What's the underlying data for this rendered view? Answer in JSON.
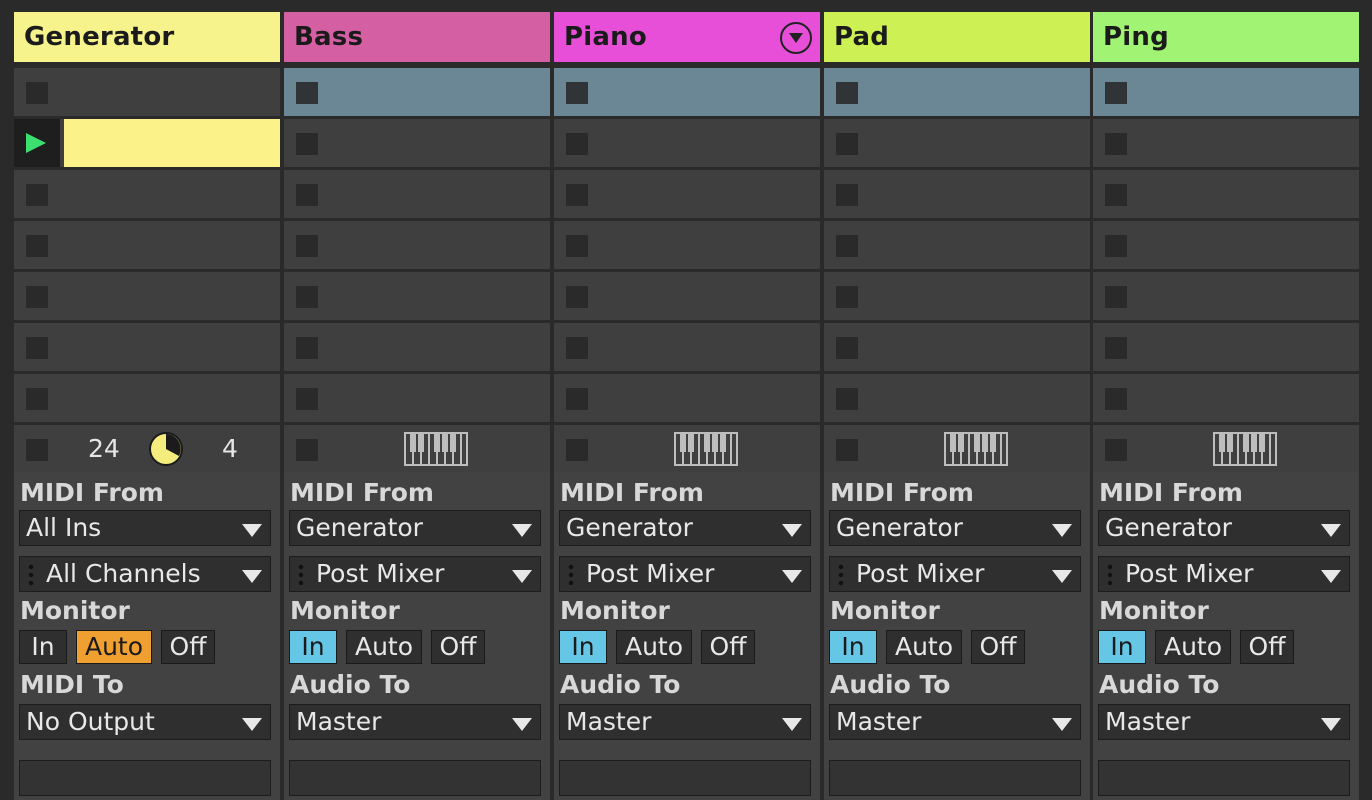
{
  "tracks": [
    {
      "name": "Generator",
      "color": "#f6f38d",
      "has_dropdown": false,
      "midi_from_label": "MIDI From",
      "input_type": "All Ins",
      "input_channel": "All Channels",
      "monitor_label": "Monitor",
      "monitor": {
        "in": "In",
        "auto": "Auto",
        "off": "Off",
        "selected": "Auto"
      },
      "output_label": "MIDI To",
      "output": "No Output",
      "footer": {
        "left_number": "24",
        "right_number": "4"
      }
    },
    {
      "name": "Bass",
      "color": "#d45fa3",
      "has_dropdown": false,
      "midi_from_label": "MIDI From",
      "input_type": "Generator",
      "input_channel": "Post Mixer",
      "monitor_label": "Monitor",
      "monitor": {
        "in": "In",
        "auto": "Auto",
        "off": "Off",
        "selected": "In"
      },
      "output_label": "Audio To",
      "output": "Master"
    },
    {
      "name": "Piano",
      "color": "#e74fd8",
      "has_dropdown": true,
      "midi_from_label": "MIDI From",
      "input_type": "Generator",
      "input_channel": "Post Mixer",
      "monitor_label": "Monitor",
      "monitor": {
        "in": "In",
        "auto": "Auto",
        "off": "Off",
        "selected": "In"
      },
      "output_label": "Audio To",
      "output": "Master"
    },
    {
      "name": "Pad",
      "color": "#cdf055",
      "has_dropdown": false,
      "midi_from_label": "MIDI From",
      "input_type": "Generator",
      "input_channel": "Post Mixer",
      "monitor_label": "Monitor",
      "monitor": {
        "in": "In",
        "auto": "Auto",
        "off": "Off",
        "selected": "In"
      },
      "output_label": "Audio To",
      "output": "Master"
    },
    {
      "name": "Ping",
      "color": "#a1f373",
      "has_dropdown": false,
      "midi_from_label": "MIDI From",
      "input_type": "Generator",
      "input_channel": "Post Mixer",
      "monitor_label": "Monitor",
      "monitor": {
        "in": "In",
        "auto": "Auto",
        "off": "Off",
        "selected": "In"
      },
      "output_label": "Audio To",
      "output": "Master"
    }
  ],
  "colors": {
    "monitor_auto_active": "#f0a030",
    "monitor_in_active": "#66c6e6",
    "selected_scene": "#6b8694",
    "playing_clip": "#fbf28a"
  },
  "icons": {
    "stop_button": "square-stop-icon",
    "play": "play-triangle-icon",
    "knob": "knob-icon",
    "keyboard": "piano-keys-icon",
    "dropdown": "circle-chevron-down-icon"
  }
}
